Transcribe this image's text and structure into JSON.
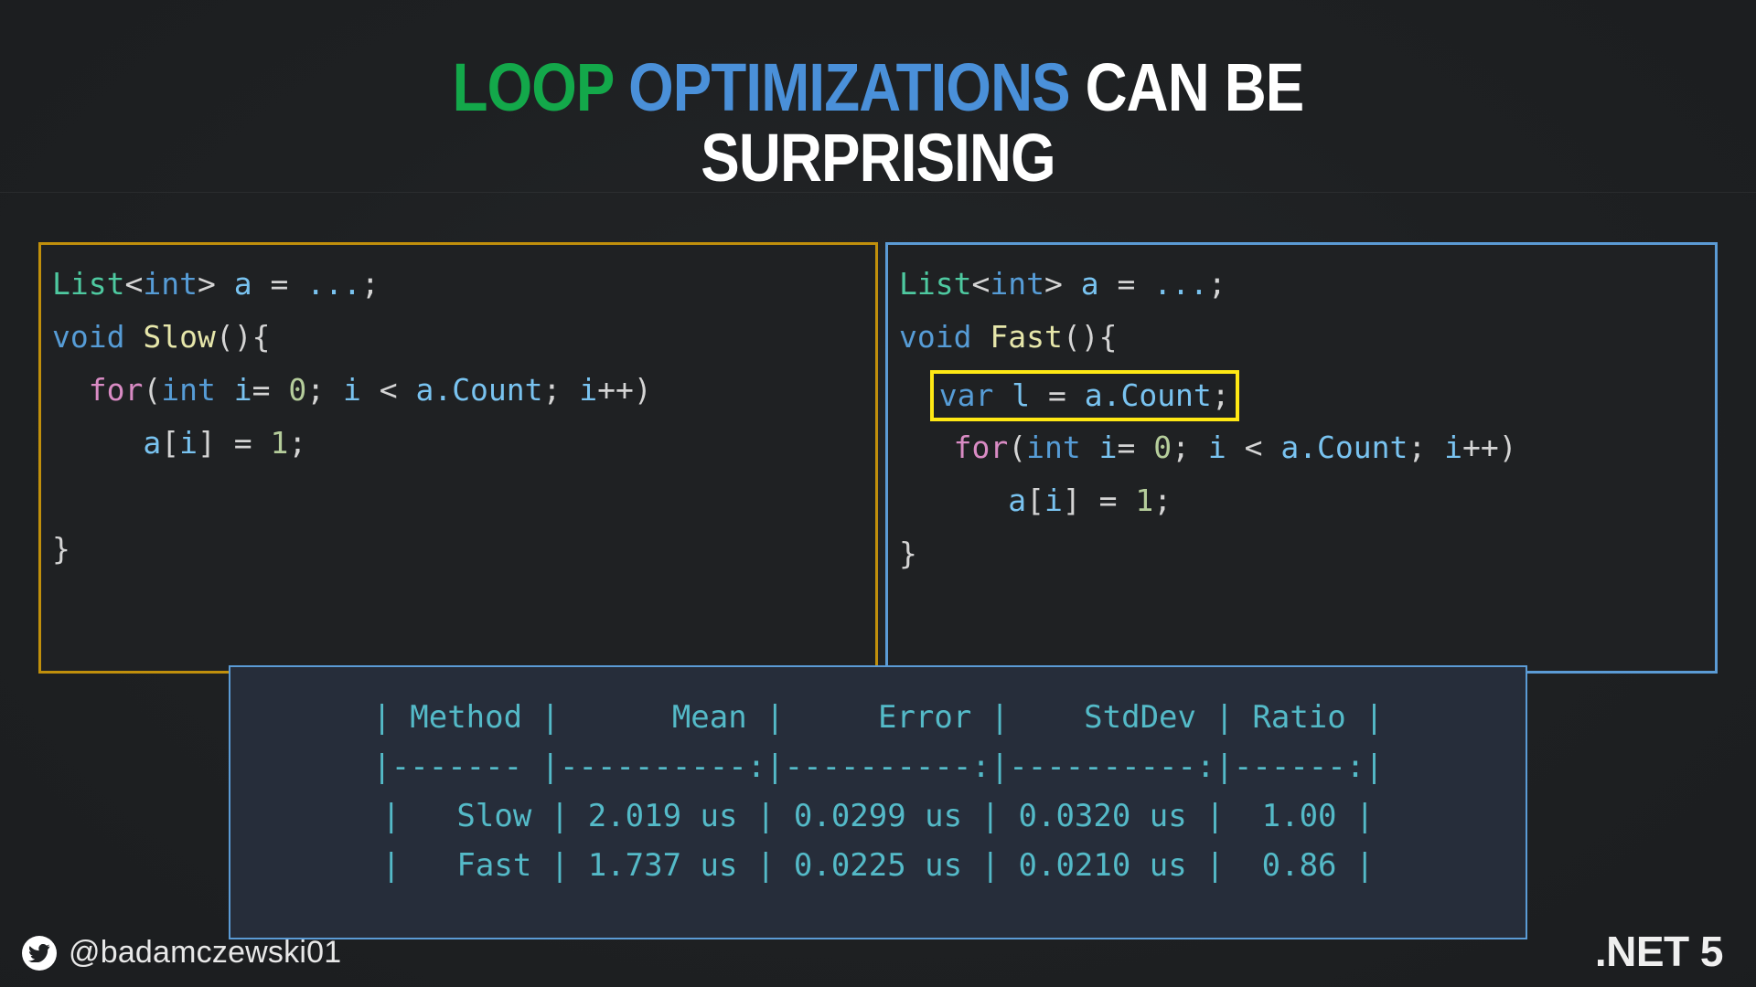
{
  "title": {
    "line1_word1": "LOOP",
    "line1_word2": "OPTIMIZATIONS",
    "line1_word3": "CAN BE",
    "line2": "SURPRISING",
    "color_word1": "#13a84a",
    "color_word2": "#4a90d9",
    "color_word3": "#ffffff"
  },
  "panels": {
    "slow": {
      "border_color": "#c08f0c",
      "lines": [
        [
          {
            "text": "List",
            "cls": "t-type"
          },
          {
            "text": "<",
            "cls": "t-punc"
          },
          {
            "text": "int",
            "cls": "t-kw"
          },
          {
            "text": "> ",
            "cls": "t-punc"
          },
          {
            "text": "a",
            "cls": "t-var"
          },
          {
            "text": " = ",
            "cls": "t-punc"
          },
          {
            "text": "...",
            "cls": "t-var"
          },
          {
            "text": ";",
            "cls": "t-punc"
          }
        ],
        [
          {
            "text": "void",
            "cls": "t-kw"
          },
          {
            "text": " ",
            "cls": "t-plain"
          },
          {
            "text": "Slow",
            "cls": "t-fn"
          },
          {
            "text": "(){",
            "cls": "t-punc"
          }
        ],
        [
          {
            "text": "  ",
            "cls": "t-plain"
          },
          {
            "text": "for",
            "cls": "t-kwctl"
          },
          {
            "text": "(",
            "cls": "t-punc"
          },
          {
            "text": "int",
            "cls": "t-kw"
          },
          {
            "text": " ",
            "cls": "t-plain"
          },
          {
            "text": "i",
            "cls": "t-var"
          },
          {
            "text": "= ",
            "cls": "t-punc"
          },
          {
            "text": "0",
            "cls": "t-num"
          },
          {
            "text": "; ",
            "cls": "t-punc"
          },
          {
            "text": "i",
            "cls": "t-var"
          },
          {
            "text": " < ",
            "cls": "t-punc"
          },
          {
            "text": "a.Count",
            "cls": "t-var"
          },
          {
            "text": "; ",
            "cls": "t-punc"
          },
          {
            "text": "i",
            "cls": "t-var"
          },
          {
            "text": "++)",
            "cls": "t-punc"
          }
        ],
        [
          {
            "text": "     ",
            "cls": "t-plain"
          },
          {
            "text": "a",
            "cls": "t-var"
          },
          {
            "text": "[",
            "cls": "t-punc"
          },
          {
            "text": "i",
            "cls": "t-var"
          },
          {
            "text": "] = ",
            "cls": "t-punc"
          },
          {
            "text": "1",
            "cls": "t-num"
          },
          {
            "text": ";",
            "cls": "t-punc"
          }
        ],
        [],
        [
          {
            "text": "}",
            "cls": "t-punc"
          }
        ]
      ]
    },
    "fast": {
      "border_color": "#5b9bd5",
      "highlight_color": "#ffe814",
      "lines": [
        [
          {
            "text": "List",
            "cls": "t-type"
          },
          {
            "text": "<",
            "cls": "t-punc"
          },
          {
            "text": "int",
            "cls": "t-kw"
          },
          {
            "text": "> ",
            "cls": "t-punc"
          },
          {
            "text": "a",
            "cls": "t-var"
          },
          {
            "text": " = ",
            "cls": "t-punc"
          },
          {
            "text": "...",
            "cls": "t-var"
          },
          {
            "text": ";",
            "cls": "t-punc"
          }
        ],
        [
          {
            "text": "void",
            "cls": "t-kw"
          },
          {
            "text": " ",
            "cls": "t-plain"
          },
          {
            "text": "Fast",
            "cls": "t-fn"
          },
          {
            "text": "(){",
            "cls": "t-punc"
          }
        ],
        [
          {
            "text": "  ",
            "cls": "t-plain"
          },
          {
            "text": "HL_START",
            "cls": "marker"
          },
          {
            "text": "var",
            "cls": "t-kw"
          },
          {
            "text": " ",
            "cls": "t-plain"
          },
          {
            "text": "l",
            "cls": "t-var"
          },
          {
            "text": " = ",
            "cls": "t-punc"
          },
          {
            "text": "a.Count",
            "cls": "t-var"
          },
          {
            "text": ";",
            "cls": "t-punc"
          },
          {
            "text": "HL_END",
            "cls": "marker"
          }
        ],
        [
          {
            "text": "   ",
            "cls": "t-plain"
          },
          {
            "text": "for",
            "cls": "t-kwctl"
          },
          {
            "text": "(",
            "cls": "t-punc"
          },
          {
            "text": "int",
            "cls": "t-kw"
          },
          {
            "text": " ",
            "cls": "t-plain"
          },
          {
            "text": "i",
            "cls": "t-var"
          },
          {
            "text": "= ",
            "cls": "t-punc"
          },
          {
            "text": "0",
            "cls": "t-num"
          },
          {
            "text": "; ",
            "cls": "t-punc"
          },
          {
            "text": "i",
            "cls": "t-var"
          },
          {
            "text": " < ",
            "cls": "t-punc"
          },
          {
            "text": "a.Count",
            "cls": "t-var"
          },
          {
            "text": "; ",
            "cls": "t-punc"
          },
          {
            "text": "i",
            "cls": "t-var"
          },
          {
            "text": "++)",
            "cls": "t-punc"
          }
        ],
        [
          {
            "text": "      ",
            "cls": "t-plain"
          },
          {
            "text": "a",
            "cls": "t-var"
          },
          {
            "text": "[",
            "cls": "t-punc"
          },
          {
            "text": "i",
            "cls": "t-var"
          },
          {
            "text": "] = ",
            "cls": "t-punc"
          },
          {
            "text": "1",
            "cls": "t-num"
          },
          {
            "text": ";",
            "cls": "t-punc"
          }
        ],
        [
          {
            "text": "}",
            "cls": "t-punc"
          }
        ]
      ]
    }
  },
  "benchmark": {
    "border_color": "#5b9bd5",
    "background_color": "#262d3a",
    "text_color": "#54bac8",
    "columns": [
      "Method",
      "Mean",
      "Error",
      "StdDev",
      "Ratio"
    ],
    "rows": [
      {
        "Method": "Slow",
        "Mean": "2.019 us",
        "Error": "0.0299 us",
        "StdDev": "0.0320 us",
        "Ratio": "1.00"
      },
      {
        "Method": "Fast",
        "Mean": "1.737 us",
        "Error": "0.0225 us",
        "StdDev": "0.0210 us",
        "Ratio": "0.86"
      }
    ],
    "raw_lines": [
      "| Method |      Mean |     Error |    StdDev | Ratio |",
      "|------- |----------:|----------:|----------:|------:|",
      "|   Slow | 2.019 us | 0.0299 us | 0.0320 us |  1.00 |",
      "|   Fast | 1.737 us | 0.0225 us | 0.0210 us |  0.86 |"
    ]
  },
  "footer": {
    "twitter_handle": "@badamczewski01",
    "twitter_icon": "twitter-bird-icon",
    "dotnet_badge": ".NET 5"
  }
}
